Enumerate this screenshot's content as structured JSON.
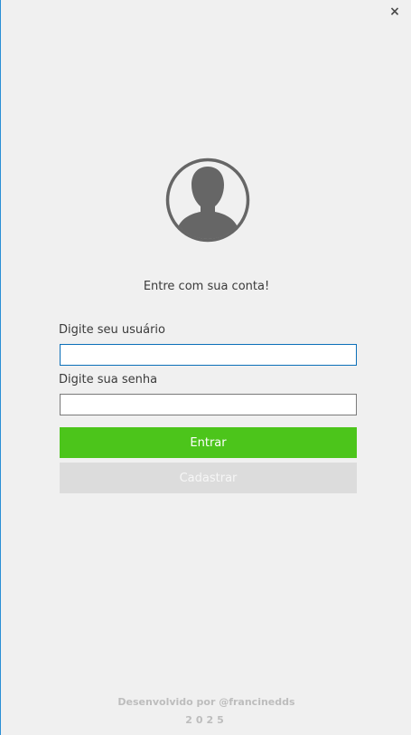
{
  "window": {
    "close_glyph": "×"
  },
  "login": {
    "heading": "Entre com sua conta!",
    "username_label": "Digite seu usuário",
    "username_value": "",
    "password_label": "Digite sua senha",
    "password_value": "",
    "login_button": "Entrar",
    "register_button": "Cadastrar"
  },
  "footer": {
    "developer": "Desenvolvido por @francinedds",
    "year": "2025"
  },
  "icons": {
    "avatar": "user-avatar-icon",
    "close": "close-icon"
  },
  "colors": {
    "accent_green": "#4cc51b",
    "focus_border": "#0b6fb8",
    "avatar_gray": "#666666",
    "background": "#f0f0f0"
  }
}
